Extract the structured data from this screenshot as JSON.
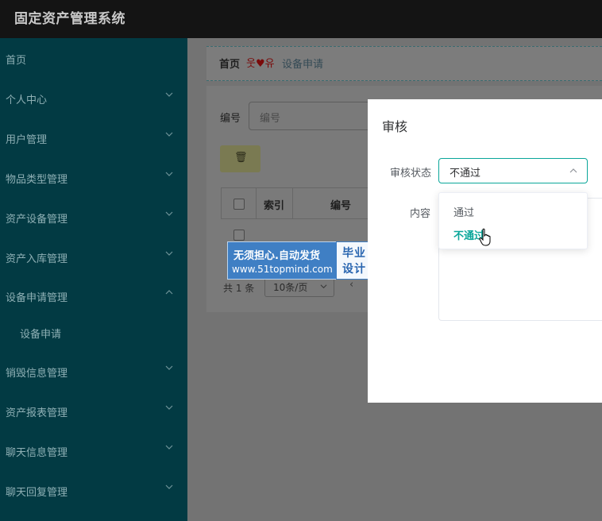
{
  "app": {
    "title": "固定资产管理系统"
  },
  "sidebar": {
    "items": [
      {
        "label": "首页"
      },
      {
        "label": "个人中心"
      },
      {
        "label": "用户管理"
      },
      {
        "label": "物品类型管理"
      },
      {
        "label": "资产设备管理"
      },
      {
        "label": "资产入库管理"
      },
      {
        "label": "设备申请管理"
      },
      {
        "label": "设备申请"
      },
      {
        "label": "销毁信息管理"
      },
      {
        "label": "资产报表管理"
      },
      {
        "label": "聊天信息管理"
      },
      {
        "label": "聊天回复管理"
      }
    ]
  },
  "breadcrumb": {
    "home": "首页",
    "decoration": "웃♥유",
    "current": "设备申请"
  },
  "search": {
    "label": "编号",
    "placeholder": "编号"
  },
  "toolbar": {
    "delete_icon": "trash-icon",
    "delete_glyph": "🗑"
  },
  "table": {
    "headers": [
      "索引",
      "编号"
    ]
  },
  "pagination": {
    "total": "共 1 条",
    "page_size": "10条/页",
    "prev": "‹"
  },
  "watermark": {
    "line1": "无须担心.自动发货",
    "line2": "www.51topmind.com",
    "box_line1": "毕业",
    "box_line2": "设计"
  },
  "dialog": {
    "title": "审核",
    "status_label": "审核状态",
    "status_value": "不通过",
    "content_label": "内容",
    "options": [
      "通过",
      "不通过"
    ]
  },
  "colors": {
    "accent": "#0aa69a",
    "sidebar_bg": "#023a43",
    "topbar_bg": "#141414"
  }
}
